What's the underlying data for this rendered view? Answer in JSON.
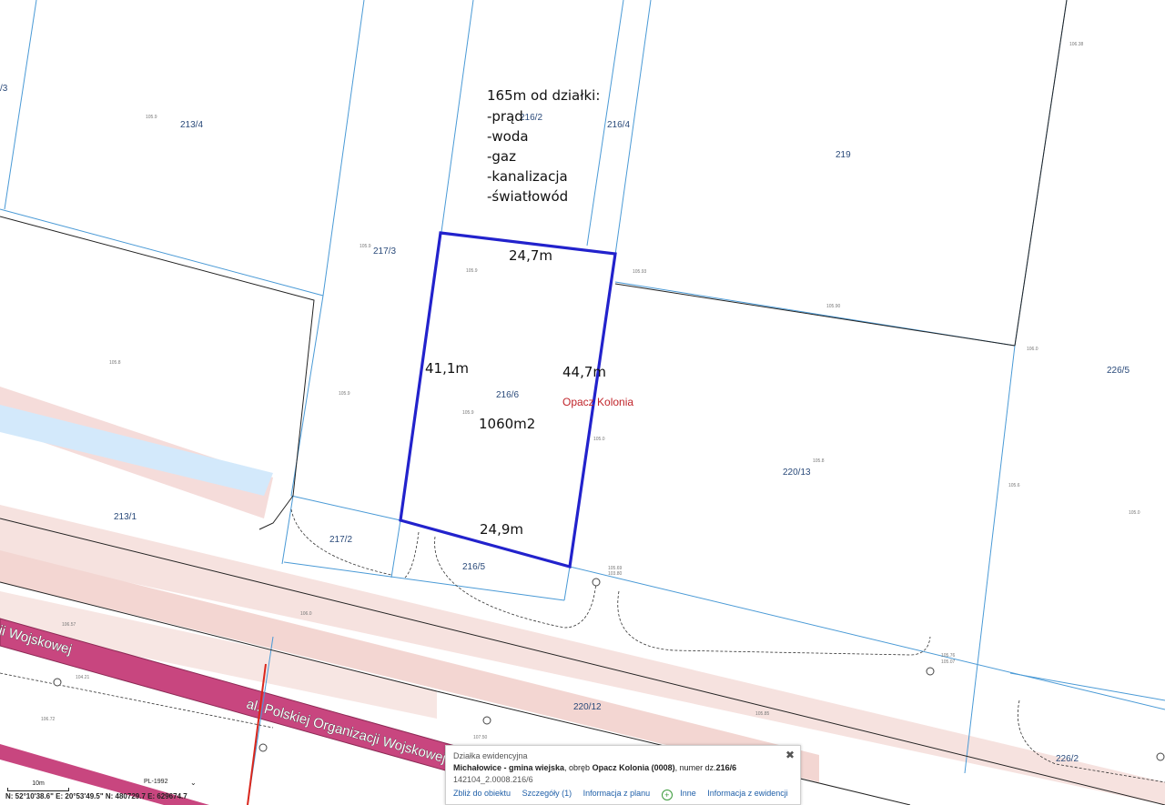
{
  "annotation": {
    "heading": "165m od działki:",
    "items": [
      "-prąd",
      "-woda",
      "-gaz",
      "-kanalizacja",
      "-światłowód"
    ]
  },
  "dimensions": {
    "top": "24,7m",
    "bottom": "24,9m",
    "left": "41,1m",
    "right": "44,7m",
    "area": "1060m2"
  },
  "parcels": {
    "p213_4": "213/4",
    "p213_3": "/3",
    "p216_2": "216/2",
    "p216_4": "216/4",
    "p219": "219",
    "p217_3": "217/3",
    "p216_6": "216/6",
    "p226_5": "226/5",
    "p220_13": "220/13",
    "p213_1": "213/1",
    "p217_2": "217/2",
    "p216_5": "216/5",
    "p220_12": "220/12",
    "p226_2": "226/2"
  },
  "place_name": "Opacz Kolonia",
  "street_name": "al. Polskiej Organizacji Wojskowej",
  "street_fragment": "aji Wojskowej",
  "heights": {
    "h1": "105.9",
    "h2": "105.9",
    "h3": "105.9",
    "h4": "105.93",
    "h5": "105.90",
    "h6": "106.0",
    "h7": "105.8",
    "h8": "105.9",
    "h9": "105.9",
    "h10": "105.0",
    "h11": "105.8",
    "h12": "105.6",
    "h13": "105.0",
    "h14": "105.69",
    "h15": "103.80",
    "h16": "105.76",
    "h17": "105.07",
    "h18": "106.0",
    "h19": "106.57",
    "h20": "104.21",
    "h21": "106.72",
    "h22": "105.85",
    "h23": "107.50",
    "h24": "106.38"
  },
  "popup": {
    "header": "Działka ewidencyjna",
    "municipality": "Michałowice - gmina wiejska",
    "precinct_prefix": ", obręb ",
    "precinct": "Opacz Kolonia (0008)",
    "number_prefix": ", numer dz.",
    "number": "216/6",
    "identifier": "142104_2.0008.216/6",
    "links": {
      "zoom": "Zbliż do obiektu",
      "details": "Szczegóły (1)",
      "plan_info": "Informacja z planu",
      "other": "Inne",
      "registry_info": "Informacja z ewidencji"
    }
  },
  "statusbar": {
    "scale_label": "10m",
    "crs": "PL-1992",
    "coords": "N: 52°10'38.6\"  E: 20°53'49.5\"  N: 480729.7  E: 629674.7"
  },
  "colors": {
    "highlight": "#2222cc",
    "parcel_line": "#4a9ad6",
    "road_pink": "#f3d9d6",
    "street_magenta": "#c8467f",
    "water": "#cfe7fb",
    "red_line": "#d9261c"
  }
}
